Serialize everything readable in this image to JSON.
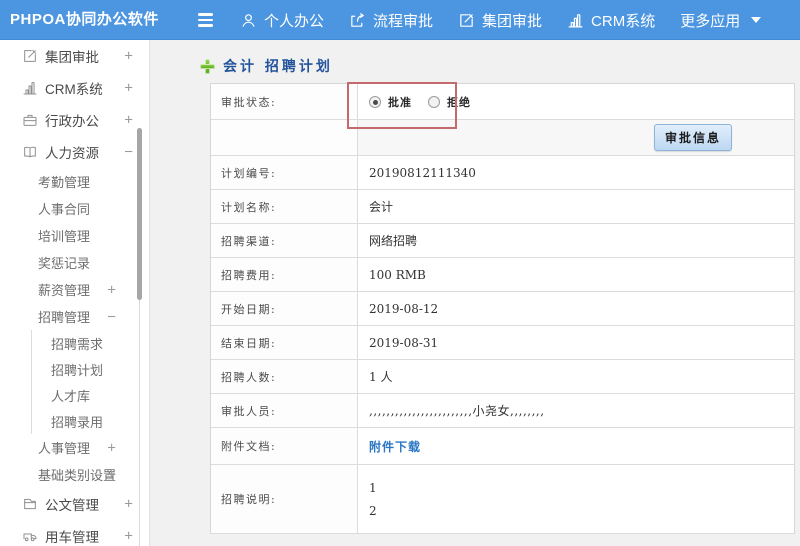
{
  "topbar": {
    "logo": "PHPOA协同办公软件",
    "nav": [
      {
        "icon": "person-icon",
        "label": "个人办公"
      },
      {
        "icon": "process-icon",
        "label": "流程审批"
      },
      {
        "icon": "edit-square-icon",
        "label": "集团审批"
      },
      {
        "icon": "bar-chart-icon",
        "label": "CRM系统"
      },
      {
        "icon": "chevron-down-icon",
        "label": "更多应用"
      }
    ]
  },
  "sidebar": {
    "items": [
      {
        "icon": "edit-square-icon",
        "label": "集团审批",
        "toggle": "+"
      },
      {
        "icon": "bar-chart-icon",
        "label": "CRM系统",
        "toggle": "+"
      },
      {
        "icon": "briefcase-icon",
        "label": "行政办公",
        "toggle": "+"
      },
      {
        "icon": "book-icon",
        "label": "人力资源",
        "toggle": "−"
      },
      {
        "icon": "",
        "label": "考勤管理",
        "toggle": ""
      },
      {
        "icon": "",
        "label": "人事合同",
        "toggle": ""
      },
      {
        "icon": "",
        "label": "培训管理",
        "toggle": ""
      },
      {
        "icon": "",
        "label": "奖惩记录",
        "toggle": ""
      },
      {
        "icon": "",
        "label": "薪资管理",
        "toggle": "+"
      },
      {
        "icon": "",
        "label": "招聘管理",
        "toggle": "−"
      },
      {
        "icon": "",
        "label": "招聘需求",
        "toggle": ""
      },
      {
        "icon": "",
        "label": "招聘计划",
        "toggle": ""
      },
      {
        "icon": "",
        "label": "人才库",
        "toggle": ""
      },
      {
        "icon": "",
        "label": "招聘录用",
        "toggle": ""
      },
      {
        "icon": "",
        "label": "人事管理",
        "toggle": "+"
      },
      {
        "icon": "",
        "label": "基础类别设置",
        "toggle": "+"
      },
      {
        "icon": "document-icon",
        "label": "公文管理",
        "toggle": "+"
      },
      {
        "icon": "car-icon",
        "label": "用车管理",
        "toggle": "+"
      }
    ]
  },
  "main": {
    "title": "会计 招聘计划",
    "approval": {
      "label": "审批状态:",
      "approve": "批准",
      "reject": "拒绝",
      "approve_selected": true,
      "button": "审批信息"
    },
    "fields": [
      {
        "label": "计划编号:",
        "value": "20190812111340"
      },
      {
        "label": "计划名称:",
        "value": "会计"
      },
      {
        "label": "招聘渠道:",
        "value": "网络招聘"
      },
      {
        "label": "招聘费用:",
        "value": "100 RMB"
      },
      {
        "label": "开始日期:",
        "value": "2019-08-12"
      },
      {
        "label": "结束日期:",
        "value": "2019-08-31"
      },
      {
        "label": "招聘人数:",
        "value": "1 人"
      },
      {
        "label": "审批人员:",
        "value": ",,,,,,,,,,,,,,,,,,,,,,,,小尧女,,,,,,,,"
      },
      {
        "label": "附件文档:",
        "value": "附件下载"
      },
      {
        "label": "招聘说明:",
        "line1": "1",
        "line2": "2"
      }
    ],
    "colors": {
      "topbar_blue": "#4c95e1",
      "title_blue": "#24549c",
      "link_blue": "#2a76c5",
      "annotation_red": "#c4696c",
      "add_icon_green": "#62b52b"
    }
  }
}
